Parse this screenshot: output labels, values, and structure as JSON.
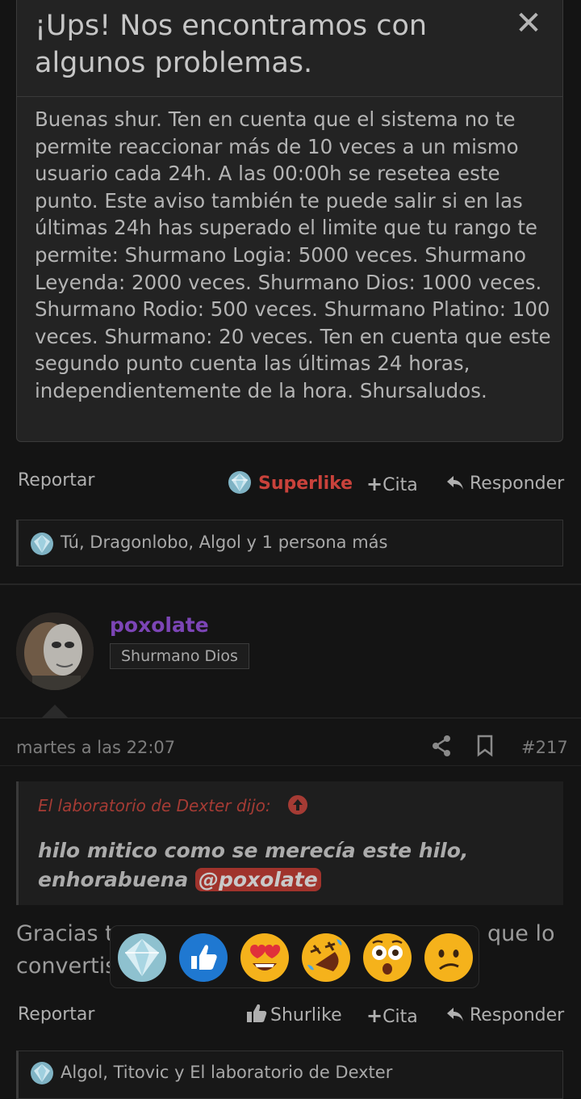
{
  "modal": {
    "title": "¡Ups! Nos encontramos con algunos problemas.",
    "close_label": "✕",
    "body": "Buenas shur. Ten en cuenta que el sistema no te permite reaccionar más de 10 veces a un mismo usuario cada 24h. A las 00:00h se resetea este punto. Este aviso también te puede salir si en las últimas 24h has superado el limite que tu rango te permite: Shurmano Logia: 5000 veces. Shurmano Leyenda: 2000 veces. Shurmano Dios: 1000 veces. Shurmano Rodio: 500 veces. Shurmano Platino: 100 veces. Shurmano: 20 veces. Ten en cuenta que este segundo punto cuenta las últimas 24 horas, independientemente de la hora. Shursaludos."
  },
  "prev_post": {
    "report_label": "Reportar",
    "superlike_label": "Superlike",
    "quote_label": "Cita",
    "reply_label": "Responder",
    "reactions_text": "Tú, Dragonlobo, Algol y 1 persona más"
  },
  "post": {
    "username": "poxolate",
    "rank": "Shurmano Dios",
    "timestamp": "martes a las 22:07",
    "number": "#217",
    "quote": {
      "attribution": "El laboratorio de Dexter dijo:",
      "text": "hilo mitico como se merecía este hilo, enhorabuena",
      "mention": "@poxolate"
    },
    "text_left_1": "Gracias t",
    "text_right_1": "que lo",
    "text_left_2": "convertis",
    "report_label": "Reportar",
    "like_label": "Shurlike",
    "quote_label": "Cita",
    "reply_label": "Responder",
    "reactions_text": "Algol, Titovic y El laboratorio de Dexter"
  },
  "colors": {
    "accent_red": "#c9423b",
    "username_purple": "#7c45b6",
    "background": "#141414"
  },
  "icons": [
    "close-icon",
    "diamond-icon",
    "plus-icon",
    "reply-icon",
    "share-icon",
    "bookmark-icon",
    "arrow-up-circle-icon",
    "thumbs-up-icon",
    "heart-eyes-emoji",
    "rofl-emoji",
    "astonished-emoji",
    "confused-emoji"
  ]
}
